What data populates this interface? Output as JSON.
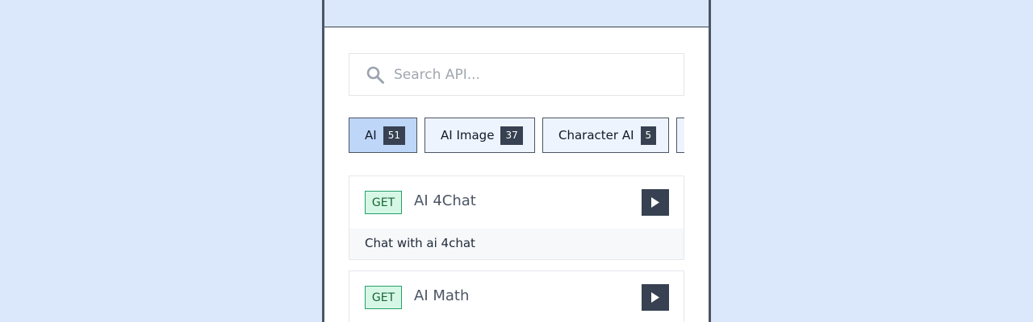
{
  "search": {
    "placeholder": "Search API..."
  },
  "categories": [
    {
      "label": "AI",
      "count": "51",
      "active": true
    },
    {
      "label": "AI Image",
      "count": "37",
      "active": false
    },
    {
      "label": "Character AI",
      "count": "5",
      "active": false
    }
  ],
  "apis": [
    {
      "method": "GET",
      "name": "AI 4Chat",
      "description": "Chat with ai 4chat"
    },
    {
      "method": "GET",
      "name": "AI Math",
      "description": ""
    }
  ],
  "colors": {
    "background": "#dbe8fc",
    "active_tab": "#bed6f8",
    "tab": "#eef4fd",
    "method_badge_bg": "#d7f7e6",
    "method_badge_border": "#22a06b",
    "dark": "#374151"
  }
}
